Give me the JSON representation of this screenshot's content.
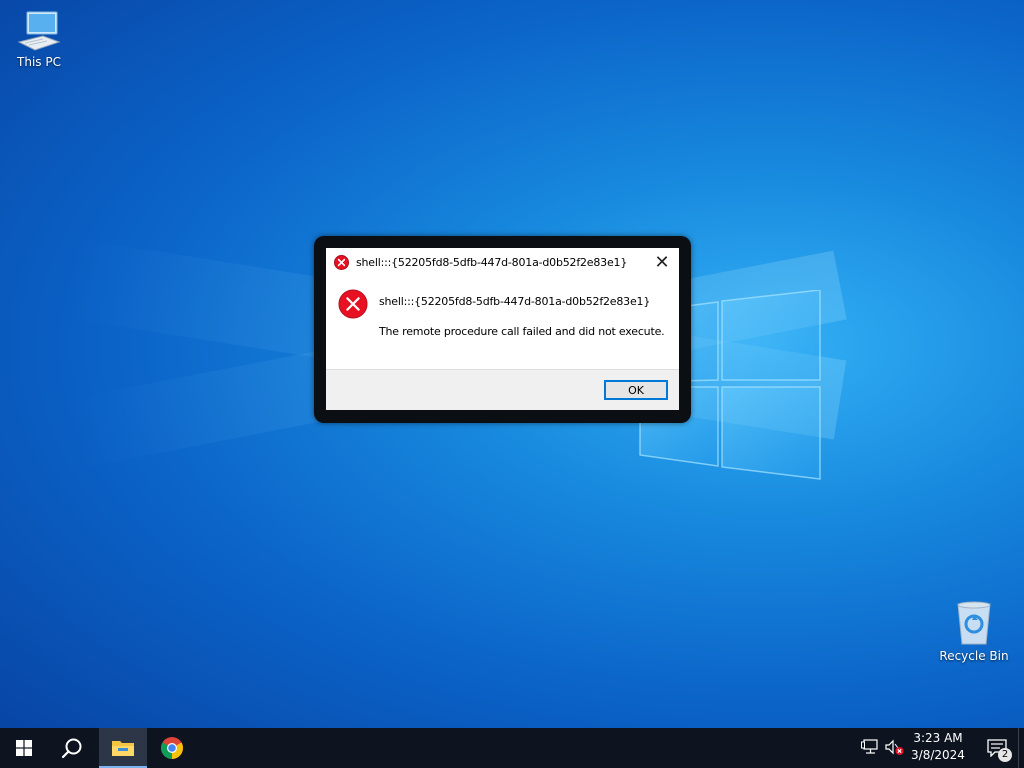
{
  "desktop": {
    "icons": [
      {
        "label": "This PC",
        "icon": "this-pc-icon"
      },
      {
        "label": "Recycle Bin",
        "icon": "recycle-bin-icon"
      }
    ]
  },
  "dialog": {
    "title": "shell:::{52205fd8-5dfb-447d-801a-d0b52f2e83e1}",
    "heading": "shell:::{52205fd8-5dfb-447d-801a-d0b52f2e83e1}",
    "message": "The remote procedure call failed and did not execute.",
    "ok_label": "OK",
    "close_glyph": "✕",
    "icon": "error-icon",
    "accent": "#0078d7",
    "error_color": "#e81123"
  },
  "taskbar": {
    "apps": [
      {
        "name": "Start",
        "icon": "windows-start-icon"
      },
      {
        "name": "Search",
        "icon": "search-icon"
      },
      {
        "name": "File Explorer",
        "icon": "folder-icon",
        "active": true
      },
      {
        "name": "Google Chrome",
        "icon": "chrome-icon"
      }
    ],
    "clock": {
      "time": "3:23 AM",
      "date": "3/8/2024"
    },
    "notifications_count": "2"
  }
}
